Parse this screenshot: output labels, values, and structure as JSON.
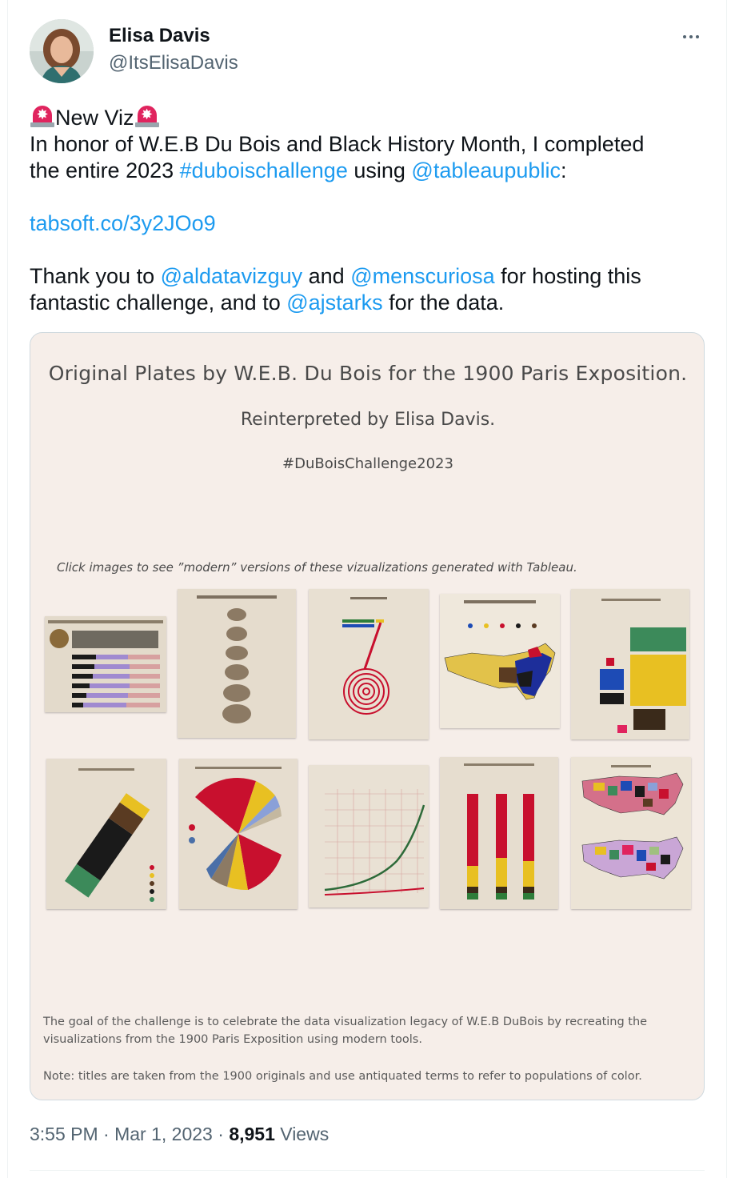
{
  "author": {
    "name": "Elisa Davis",
    "handle": "@ItsElisaDavis"
  },
  "tweet": {
    "line1_text": "New Viz",
    "line2": "In honor of W.E.B Du Bois and Black History Month, I completed",
    "line3_pre": "the entire 2023 ",
    "line3_hashtag": "#duboischallenge",
    "line3_mid": " using ",
    "line3_mention": "@tableaupublic",
    "line3_post": ":",
    "url": "tabsoft.co/3y2JOo9",
    "line5_pre": "Thank you to ",
    "line5_mention1": "@aldatavizguy",
    "line5_mid": " and ",
    "line5_mention2": "@menscuriosa",
    "line5_post": " for hosting this",
    "line6_pre": "fantastic challenge, and to ",
    "line6_mention": "@ajstarks",
    "line6_post": " for the data."
  },
  "card": {
    "title": "Original Plates by W.E.B. Du Bois for the 1900 Paris Exposition.",
    "subtitle": "Reinterpreted by Elisa Davis.",
    "hashtag": "#DuBoisChallenge2023",
    "hint": "Click images to see ”modern” versions of these vizualizations generated with Tableau.",
    "footer1": "The goal of the challenge is to celebrate the data visualization legacy of W.E.B DuBois by recreating the visualizations from the 1900 Paris Exposition using modern tools.",
    "footer2": "Note: titles are taken from the 1900 originals and use antiquated terms to refer to populations of color."
  },
  "meta": {
    "time": "3:55 PM",
    "sep1": " · ",
    "date": "Mar 1, 2023",
    "sep2": " · ",
    "views": "8,951",
    "views_label": " Views"
  },
  "colors": {
    "link": "#1d9bf0",
    "du_red": "#c8102e",
    "du_gold": "#e8c022",
    "du_green": "#2e7d3a",
    "du_blue": "#1d4bb5",
    "du_black": "#1a1a1a",
    "du_brown": "#5a3b22"
  }
}
